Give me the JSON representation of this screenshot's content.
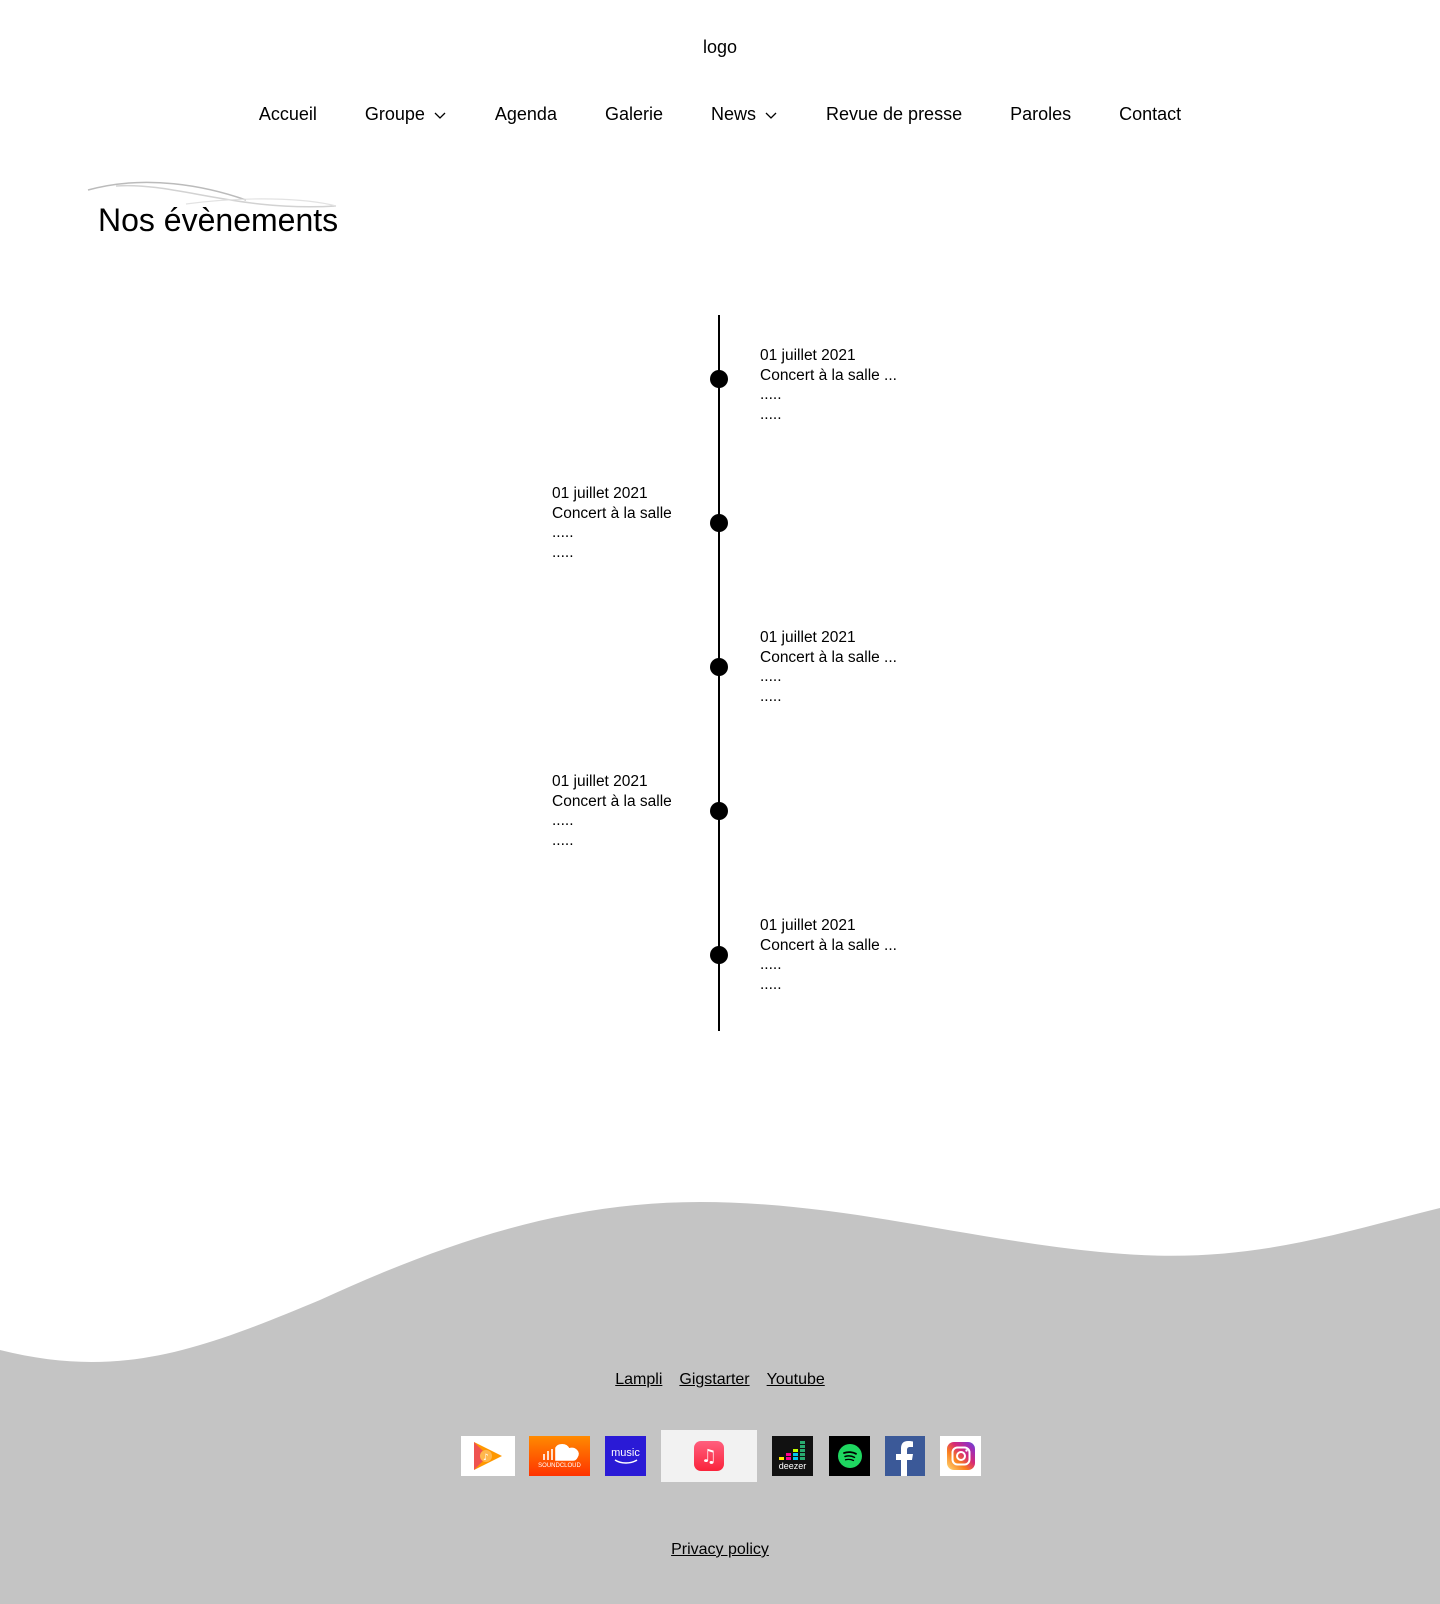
{
  "header": {
    "logo_text": "logo",
    "nav": [
      {
        "label": "Accueil"
      },
      {
        "label": "Groupe",
        "dropdown": true
      },
      {
        "label": "Agenda"
      },
      {
        "label": "Galerie"
      },
      {
        "label": "News",
        "dropdown": true
      },
      {
        "label": "Revue de presse"
      },
      {
        "label": "Paroles"
      },
      {
        "label": "Contact"
      }
    ]
  },
  "main": {
    "title": "Nos évènements",
    "events": [
      {
        "side": "right",
        "date": "01 juillet 2021",
        "desc": "Concert à la salle ...",
        "line3": ".....",
        "line4": "....."
      },
      {
        "side": "left",
        "date": "01 juillet 2021",
        "desc": "Concert à la salle",
        "line3": ".....",
        "line4": "....."
      },
      {
        "side": "right",
        "date": "01 juillet 2021",
        "desc": "Concert à la salle ...",
        "line3": ".....",
        "line4": "....."
      },
      {
        "side": "left",
        "date": "01 juillet 2021",
        "desc": "Concert à la salle",
        "line3": ".....",
        "line4": "....."
      },
      {
        "side": "right",
        "date": "01 juillet 2021",
        "desc": "Concert à la salle ...",
        "line3": ".....",
        "line4": "....."
      }
    ]
  },
  "footer": {
    "links": [
      "Lampli",
      "Gigstarter",
      "Youtube"
    ],
    "icons": [
      "google-play-music-icon",
      "soundcloud-icon",
      "amazon-music-icon",
      "apple-music-icon",
      "deezer-icon",
      "spotify-icon",
      "facebook-icon",
      "instagram-icon"
    ],
    "soundcloud_text": "SOUNDCLOUD",
    "amazon_text": "music",
    "deezer_text": "deezer",
    "privacy": "Privacy policy",
    "background_color": "#c4c4c4"
  }
}
